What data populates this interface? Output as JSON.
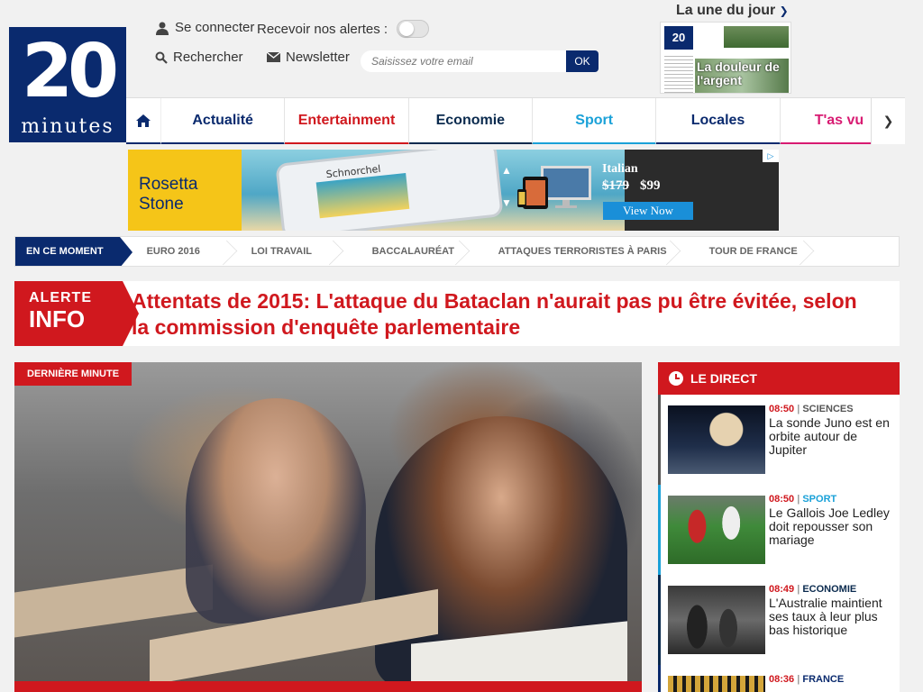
{
  "header": {
    "logo": {
      "big": "20",
      "small": "minutes"
    },
    "login_label": "Se connecter",
    "alerts_label": "Recevoir nos alertes :",
    "search_label": "Rechercher",
    "newsletter_label": "Newsletter",
    "email_placeholder": "Saisissez votre email",
    "ok_label": "OK",
    "une_title": "La une du jour",
    "une_headline": "La douleur de l'argent"
  },
  "nav": {
    "tabs": [
      {
        "label": "Actualité",
        "color": "#0a2a6e"
      },
      {
        "label": "Entertainment",
        "color": "#d0181e"
      },
      {
        "label": "Economie",
        "color": "#0a2a4e"
      },
      {
        "label": "Sport",
        "color": "#1aa1d8"
      },
      {
        "label": "Locales",
        "color": "#0a2a6e"
      },
      {
        "label": "T'as vu",
        "color": "#d81b72"
      }
    ]
  },
  "ad": {
    "brand": "Rosetta Stone",
    "device_label": "Schnorchel",
    "language": "Italian",
    "old_price": "$179",
    "new_price": "$99",
    "cta": "View Now"
  },
  "trending": {
    "lead": "EN CE MOMENT",
    "topics": [
      "EURO 2016",
      "LOI TRAVAIL",
      "BACCALAURÉAT",
      "ATTAQUES TERRORISTES À PARIS",
      "TOUR DE FRANCE"
    ]
  },
  "alert": {
    "tag_line1": "ALERTE",
    "tag_line2": "INFO",
    "headline": "Attentats de 2015: L'attaque du Bataclan n'aurait pas pu être évitée, selon la commission d'enquête parlementaire"
  },
  "hero": {
    "label": "DERNIÈRE MINUTE"
  },
  "live": {
    "title": "LE DIRECT",
    "items": [
      {
        "time": "08:50",
        "category": "SCIENCES",
        "category_color": "#555555",
        "title": "La sonde Juno est en orbite autour de Jupiter"
      },
      {
        "time": "08:50",
        "category": "SPORT",
        "category_color": "#1aa1d8",
        "title": "Le Gallois Joe Ledley doit repousser son mariage"
      },
      {
        "time": "08:49",
        "category": "ECONOMIE",
        "category_color": "#0a2a4e",
        "title": "L'Australie maintient ses taux à leur plus bas historique"
      },
      {
        "time": "08:36",
        "category": "FRANCE",
        "category_color": "#0a2a6e",
        "title": ""
      }
    ]
  },
  "colors": {
    "brand": "#0a2a6e",
    "alert": "#d0181e"
  }
}
